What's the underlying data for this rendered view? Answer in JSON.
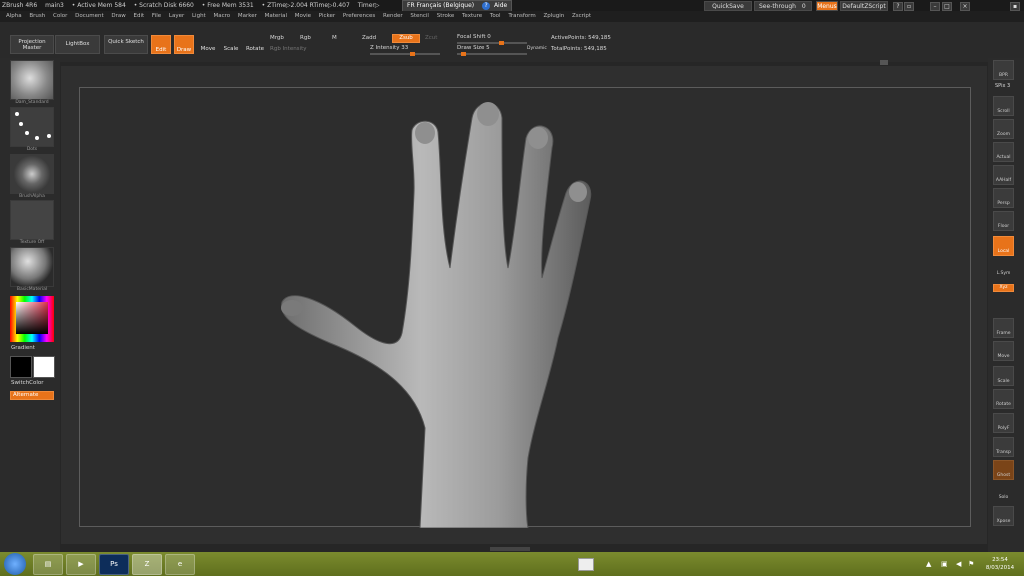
{
  "titlebar": {
    "items": [
      "ZBrush 4R6",
      "main3",
      "• Active Mem 584",
      "• Scratch Disk 6660",
      "• Free Mem 3531",
      "• ZTime▷2.004 RTime▷0.407",
      "Timer▷"
    ],
    "language": "FR Français (Belgique)",
    "help": "Aide",
    "quicksave": "QuickSave",
    "seethrough": "See-through",
    "seethrough_value": "0",
    "menus": "Menus",
    "zscript": "DefaultZScript"
  },
  "menubar": [
    "Alpha",
    "Brush",
    "Color",
    "Document",
    "Draw",
    "Edit",
    "File",
    "Layer",
    "Light",
    "Macro",
    "Marker",
    "Material",
    "Movie",
    "Picker",
    "Preferences",
    "Render",
    "Stencil",
    "Stroke",
    "Texture",
    "Tool",
    "Transform",
    "Zplugin",
    "Zscript"
  ],
  "shelf": {
    "projection_master": "Projection Master",
    "lightbox": "LightBox",
    "quick_sketch": "Quick Sketch",
    "edit": "Edit",
    "draw": "Draw",
    "move": "Move",
    "scale": "Scale",
    "rotate": "Rotate",
    "mrgb": "Mrgb",
    "rgb": "Rgb",
    "m": "M",
    "rgb_intensity": "Rgb Intensity",
    "zadd": "Zadd",
    "zsub": "Zsub",
    "zcut": "Zcut",
    "z_intensity_label": "Z Intensity",
    "z_intensity_value": "33",
    "focal_shift_label": "Focal Shift",
    "focal_shift_value": "0",
    "draw_size_label": "Draw Size",
    "draw_size_value": "5",
    "dynamic": "Dynamic",
    "active_points_label": "ActivePoints:",
    "active_points_value": "549,185",
    "total_points_label": "TotalPoints:",
    "total_points_value": "549,185"
  },
  "leftpanel": {
    "brush": "Dam_Standard",
    "stroke": "Dots",
    "alpha": "BrushAlpha",
    "texture": "Texture Off",
    "material": "BasicMaterial",
    "gradient": "Gradient",
    "switchcolor": "SwitchColor",
    "alternate": "Alternate"
  },
  "rightpanel": [
    "BPR",
    "SPix 3",
    "Scroll",
    "Zoom",
    "Actual",
    "AAHalf",
    "Persp",
    "Floor",
    "Local",
    "L.Sym",
    "Xyz",
    "Frame",
    "Move",
    "Scale",
    "Rotate",
    "PolyF",
    "Transp",
    "Ghost",
    "Solo",
    "Xpose"
  ],
  "taskbar": {
    "time": "23:54",
    "date": "8/03/2014"
  },
  "colors": {
    "accent": "#e8731a",
    "background": "#262626",
    "taskbar": "#6f7f25"
  }
}
